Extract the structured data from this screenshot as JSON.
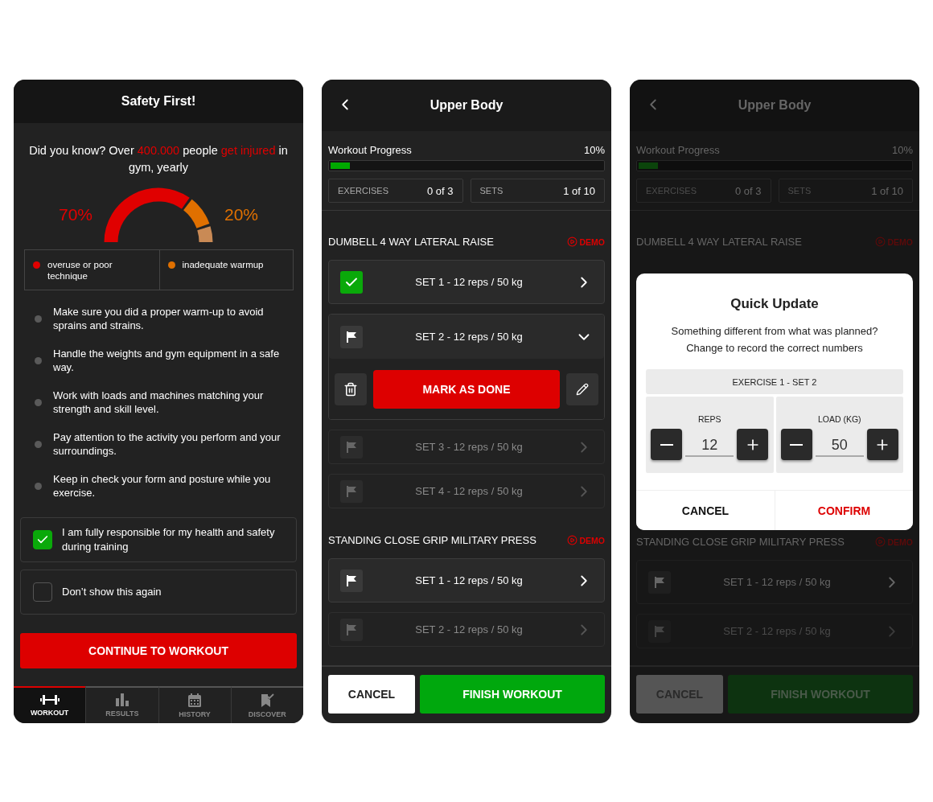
{
  "safety_screen": {
    "title": "Safety First!",
    "intro": "Did you know? Over **400.000** people **get injured** in gym, yearly",
    "gauge": {
      "left_label": "70%",
      "right_label": "20%"
    },
    "legend": [
      {
        "label": "overuse or poor technique",
        "color": "#e00000"
      },
      {
        "label": "inadequate warmup",
        "color": "#e07000"
      }
    ],
    "tips": [
      "Make sure you did a proper warm-up to avoid sprains and strains.",
      "Handle the weights and gym equipment in a safe way.",
      "Work with loads and machines matching your strength and skill level.",
      "Pay attention to the activity you perform and your surroundings.",
      "Keep in check your form and posture while you exercise."
    ],
    "agreements": [
      {
        "label": "I am fully responsible for my health and safety during training",
        "checked": true
      },
      {
        "label": "Don’t show this again",
        "checked": false
      }
    ],
    "continue_button": "CONTINUE TO WORKOUT",
    "tabs": [
      {
        "label": "WORKOUT",
        "selected": true
      },
      {
        "label": "RESULTS",
        "selected": false
      },
      {
        "label": "HISTORY",
        "selected": false
      },
      {
        "label": "DISCOVER",
        "selected": false
      }
    ]
  },
  "workout_screen": {
    "title": "Upper Body",
    "progress": {
      "label": "Workout Progress",
      "reading": "10%",
      "level": 0.07
    },
    "stats": [
      {
        "label": "EXERCISES",
        "value": "0 of 3"
      },
      {
        "label": "SETS",
        "value": "1 of 10"
      }
    ],
    "exercises": [
      {
        "name": "DUMBELL 4 WAY LATERAL RAISE",
        "demo": "DEMO",
        "sets": [
          {
            "label": "SET 1 - 12 reps / 50 kg",
            "done": true,
            "expanded": false
          },
          {
            "label": "SET 2 - 12 reps / 50 kg",
            "done": false,
            "active": true,
            "expanded": true,
            "action": "MARK AS DONE"
          },
          {
            "label": "SET 3 - 12 reps / 50 kg",
            "done": false,
            "active": false,
            "expanded": false
          },
          {
            "label": "SET 4 - 12 reps / 50 kg",
            "done": false,
            "active": false,
            "expanded": false
          }
        ]
      },
      {
        "name": "STANDING CLOSE GRIP MILITARY PRESS",
        "demo": "DEMO",
        "sets": [
          {
            "label": "SET 1 - 12 reps / 50 kg",
            "done": false,
            "active": true,
            "expanded": false
          },
          {
            "label": "SET 2 - 12 reps / 50 kg",
            "done": false,
            "active": false,
            "expanded": false
          }
        ]
      }
    ],
    "cancel": "CANCEL",
    "finish": "FINISH WORKOUT"
  },
  "update_screen": {
    "title": "Upper Body",
    "progress": {
      "label": "Workout Progress",
      "reading": "10%",
      "level": 0.07
    },
    "stats": [
      {
        "label": "EXERCISES",
        "value": "0 of 3"
      },
      {
        "label": "SETS",
        "value": "1 of 10"
      }
    ],
    "exercises": [
      {
        "name": "DUMBELL 4 WAY LATERAL RAISE",
        "demo": "DEMO"
      },
      {
        "name": "STANDING CLOSE GRIP MILITARY PRESS",
        "demo": "DEMO",
        "sets": [
          {
            "label": "SET 1 - 12 reps / 50 kg",
            "done": false,
            "active": true,
            "expanded": false
          },
          {
            "label": "SET 2 - 12 reps / 50 kg",
            "done": false,
            "active": false,
            "expanded": false
          }
        ]
      }
    ],
    "cancel": "CANCEL",
    "finish": "FINISH WORKOUT",
    "dialog": {
      "title": "Quick Update",
      "message": [
        "Something different from what was planned?",
        "Change to record the correct numbers"
      ],
      "exercise": "EXERCISE 1 - SET 2",
      "fields": [
        {
          "label": "REPS",
          "value": "12"
        },
        {
          "label": "LOAD (KG)",
          "value": "50"
        }
      ],
      "cancel": "CANCEL",
      "confirm": "CONFIRM"
    }
  }
}
